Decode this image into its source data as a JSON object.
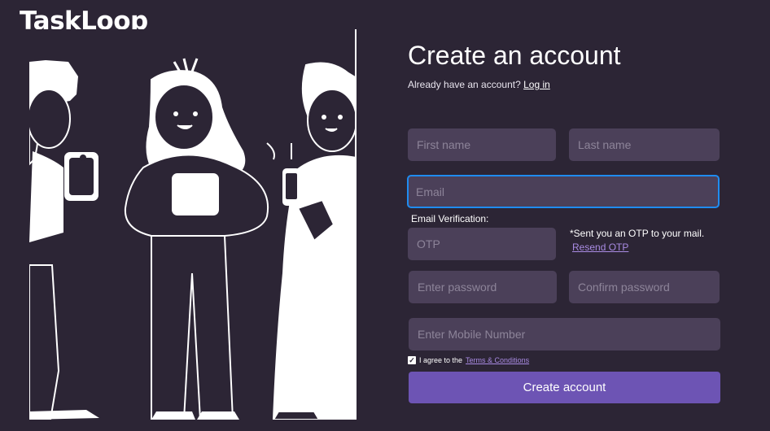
{
  "app": {
    "logo": "TaskLoop"
  },
  "header": {
    "title": "Create an account",
    "subtitle_text": "Already have an account?",
    "login_link": "Log in"
  },
  "form": {
    "first_name": {
      "placeholder": "First name",
      "value": ""
    },
    "last_name": {
      "placeholder": "Last name",
      "value": ""
    },
    "email": {
      "placeholder": "Email",
      "value": ""
    },
    "email_verification_label": "Email Verification:",
    "otp": {
      "placeholder": "OTP",
      "value": ""
    },
    "otp_note": "*Sent you an OTP to your mail.",
    "resend_otp": "Resend OTP",
    "password": {
      "placeholder": "Enter password",
      "value": ""
    },
    "confirm_password": {
      "placeholder": "Confirm password",
      "value": ""
    },
    "mobile": {
      "placeholder": "Enter Mobile Number",
      "value": ""
    },
    "agree_text": "I agree to the",
    "terms_link": "Terms & Conditions",
    "agree_checked": true,
    "submit_label": "Create account"
  },
  "colors": {
    "background": "#2c2535",
    "field_bg": "#4b4059",
    "focus_border": "#1f8cf0",
    "accent": "#6d54b4",
    "link_accent": "#a98be3"
  },
  "icons": {
    "checkbox": "check-icon"
  }
}
